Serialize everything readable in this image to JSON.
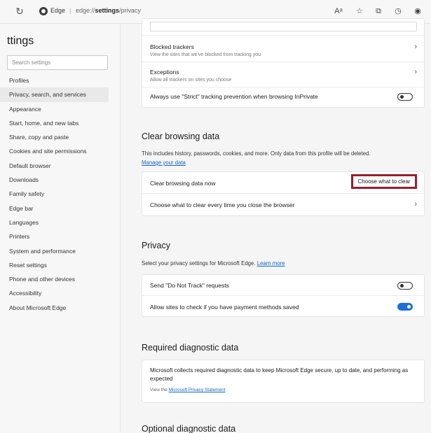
{
  "browser": {
    "site_name": "Edge",
    "separator": "|",
    "url_prefix": "edge://",
    "url_bold": "settings",
    "url_suffix": "/privacy"
  },
  "sidebar": {
    "title": "ttings",
    "search_placeholder": "Search settings",
    "items": [
      {
        "label": "Profiles"
      },
      {
        "label": "Privacy, search, and services"
      },
      {
        "label": "Appearance"
      },
      {
        "label": "Start, home, and new tabs"
      },
      {
        "label": "Share, copy and paste"
      },
      {
        "label": "Cookies and site permissions"
      },
      {
        "label": "Default browser"
      },
      {
        "label": "Downloads"
      },
      {
        "label": "Family safety"
      },
      {
        "label": "Edge bar"
      },
      {
        "label": "Languages"
      },
      {
        "label": "Printers"
      },
      {
        "label": "System and performance"
      },
      {
        "label": "Reset settings"
      },
      {
        "label": "Phone and other devices"
      },
      {
        "label": "Accessibility"
      },
      {
        "label": "About Microsoft Edge"
      }
    ]
  },
  "tracking": {
    "blocked_label": "Blocked trackers",
    "blocked_sub": "View the sites that we've blocked from tracking you",
    "exceptions_label": "Exceptions",
    "exceptions_sub": "Allow all trackers on sites you choose",
    "strict_label": "Always use \"Strict\" tracking prevention when browsing InPrivate"
  },
  "clear": {
    "title": "Clear browsing data",
    "desc": "This includes history, passwords, cookies, and more. Only data from this profile will be deleted.",
    "manage_link": "Manage your data",
    "now_label": "Clear browsing data now",
    "button_label": "Choose what to clear",
    "on_close_label": "Choose what to clear every time you close the browser"
  },
  "privacy": {
    "title": "Privacy",
    "desc": "Select your privacy settings for Microsoft Edge.",
    "learn_more": "Learn more",
    "dnt_label": "Send \"Do Not Track\" requests",
    "payment_label": "Allow sites to check if you have payment methods saved"
  },
  "diagnostic": {
    "title": "Required diagnostic data",
    "text": "Microsoft collects required diagnostic data to keep Microsoft Edge secure, up to date, and performing as expected",
    "view_the": "View the",
    "statement_link": "Microsoft Privacy Statement",
    "optional_title": "Optional diagnostic data"
  },
  "toggles": {
    "strict": "off",
    "dnt": "off",
    "payment": "on"
  },
  "colors": {
    "accent": "#1e6fd9",
    "highlight_border": "#9b1c2e"
  }
}
